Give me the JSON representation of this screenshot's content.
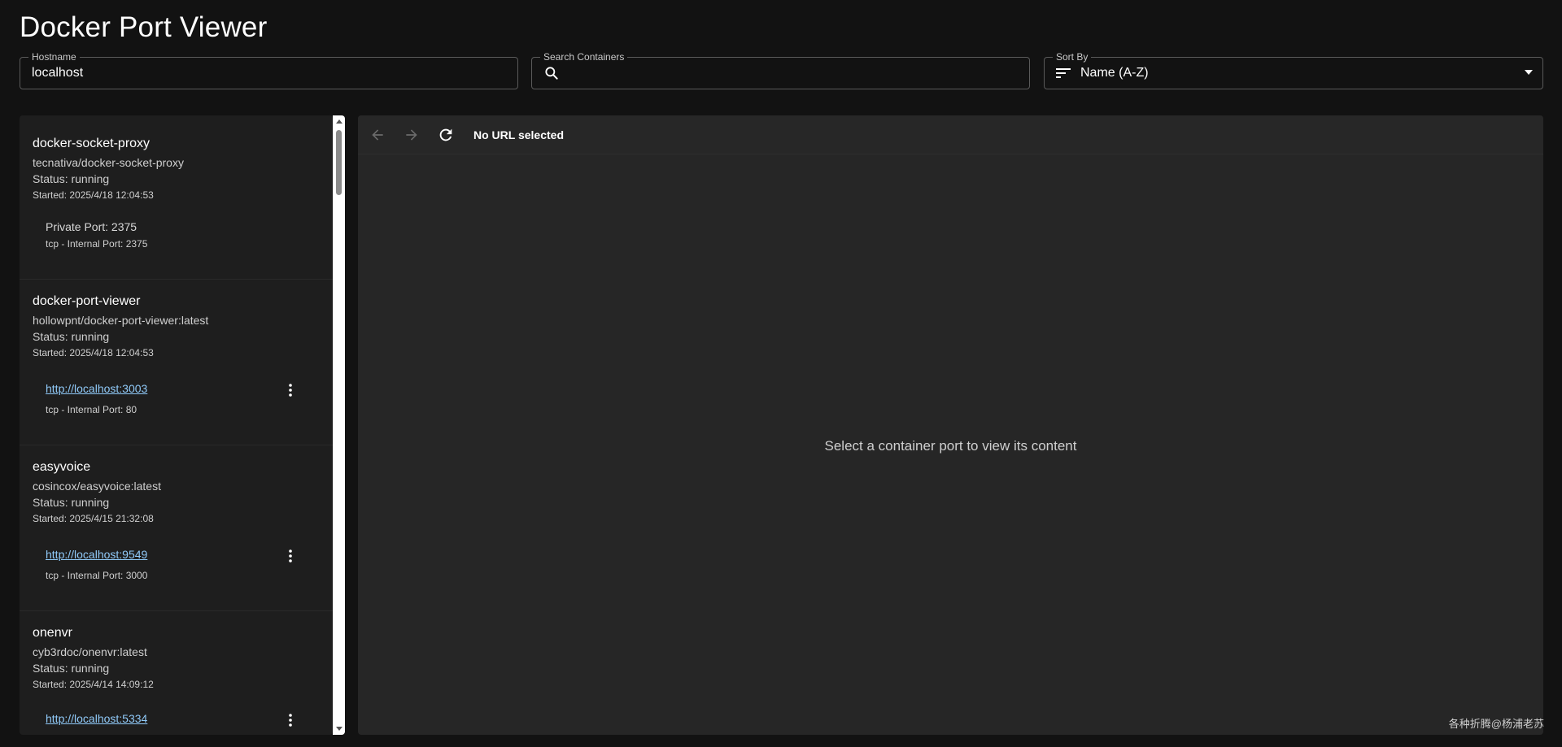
{
  "app": {
    "title": "Docker Port Viewer"
  },
  "filters": {
    "hostname": {
      "label": "Hostname",
      "value": "localhost"
    },
    "search": {
      "label": "Search Containers",
      "value": "",
      "icon": "search-icon"
    },
    "sort": {
      "label": "Sort By",
      "value": "Name (A-Z)",
      "icon": "sort-icon"
    }
  },
  "containers": [
    {
      "name": "docker-socket-proxy",
      "image": "tecnativa/docker-socket-proxy",
      "status": "Status: running",
      "started": "Started: 2025/4/18 12:04:53",
      "ports": [
        {
          "main": "Private Port: 2375",
          "is_link": false,
          "sub": "tcp - Internal Port: 2375"
        }
      ]
    },
    {
      "name": "docker-port-viewer",
      "image": "hollowpnt/docker-port-viewer:latest",
      "status": "Status: running",
      "started": "Started: 2025/4/18 12:04:53",
      "ports": [
        {
          "main": "http://localhost:3003",
          "is_link": true,
          "sub": "tcp - Internal Port: 80"
        }
      ]
    },
    {
      "name": "easyvoice",
      "image": "cosincox/easyvoice:latest",
      "status": "Status: running",
      "started": "Started: 2025/4/15 21:32:08",
      "ports": [
        {
          "main": "http://localhost:9549",
          "is_link": true,
          "sub": "tcp - Internal Port: 3000"
        }
      ]
    },
    {
      "name": "onenvr",
      "image": "cyb3rdoc/onenvr:latest",
      "status": "Status: running",
      "started": "Started: 2025/4/14 14:09:12",
      "ports": [
        {
          "main": "http://localhost:5334",
          "is_link": true,
          "sub": ""
        }
      ]
    }
  ],
  "viewer": {
    "url_text": "No URL selected",
    "empty_message": "Select a container port to view its content"
  },
  "watermark": "各种折腾@杨浦老苏",
  "colors": {
    "background": "#121212",
    "panel": "#1e1e1e",
    "link": "#90caf9"
  }
}
